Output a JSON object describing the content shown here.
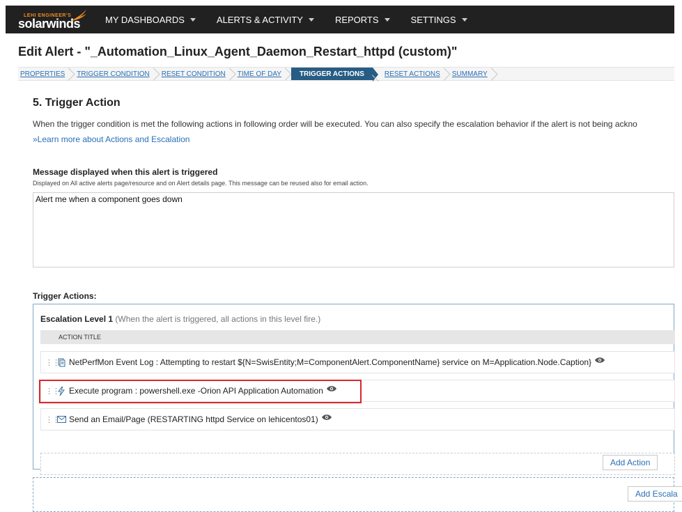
{
  "brand": {
    "tagline": "LEHI ENGINEER'S",
    "name": "solarwinds",
    "flame_color": "#f08a24"
  },
  "nav": [
    {
      "label": "MY DASHBOARDS"
    },
    {
      "label": "ALERTS & ACTIVITY"
    },
    {
      "label": "REPORTS"
    },
    {
      "label": "SETTINGS"
    }
  ],
  "page": {
    "title": "Edit Alert - \"_Automation_Linux_Agent_Daemon_Restart_httpd (custom)\""
  },
  "steps": [
    {
      "label": "PROPERTIES",
      "active": false
    },
    {
      "label": "TRIGGER CONDITION",
      "active": false
    },
    {
      "label": "RESET CONDITION",
      "active": false
    },
    {
      "label": "TIME OF DAY",
      "active": false
    },
    {
      "label": "TRIGGER ACTIONS",
      "active": true
    },
    {
      "label": "RESET ACTIONS",
      "active": false
    },
    {
      "label": "SUMMARY",
      "active": false
    }
  ],
  "section": {
    "heading": "5. Trigger Action",
    "description": "When the trigger condition is met the following actions in following order will be executed. You can also specify the escalation behavior if the alert is not being ackno",
    "learn_more": "»Learn more about Actions and Escalation"
  },
  "message": {
    "label": "Message displayed when this alert is triggered",
    "sublabel": "Displayed on All active alerts page/resource and on Alert details page. This message can be reused also for email action.",
    "value": "Alert me when a component goes down"
  },
  "trigger_actions": {
    "label": "Trigger Actions:",
    "escalation": {
      "title": "Escalation Level 1",
      "hint": "(When the alert is triggered, all actions in this level fire.)",
      "column_header": "ACTION TITLE",
      "actions": [
        {
          "icon": "event-log-icon",
          "text": "NetPerfMon Event Log : Attempting to restart ${N=SwisEntity;M=ComponentAlert.ComponentName} service on M=Application.Node.Caption}"
        },
        {
          "icon": "lightning-icon",
          "text": "Execute program : powershell.exe -Orion API Application Automation",
          "highlighted": true
        },
        {
          "icon": "email-icon",
          "text": "Send an Email/Page (RESTARTING httpd Service on lehicentos01)"
        }
      ],
      "add_action": "Add Action"
    },
    "add_escalation": "Add Escala"
  },
  "colors": {
    "nav_bg": "#212121",
    "active_step": "#275d84",
    "link": "#2a6fb5",
    "highlight_border": "#d9262c"
  }
}
